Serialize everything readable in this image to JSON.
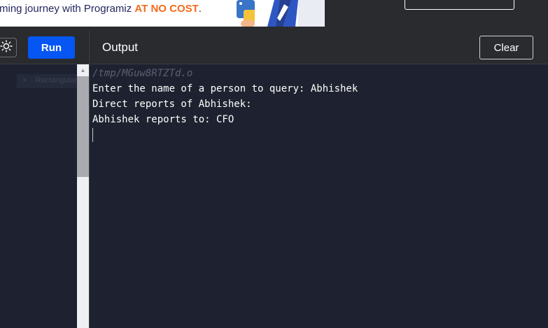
{
  "banner": {
    "text_main": "ming journey with Programiz ",
    "text_highlight": "AT NO COST",
    "text_end": "."
  },
  "toolbar": {
    "run_label": "Run",
    "output_title": "Output",
    "clear_label": "Clear"
  },
  "editor": {
    "hint": "Rectangular S"
  },
  "output": {
    "lines": [
      "/tmp/MGuw8RTZTd.o",
      "Enter the name of a person to query: Abhishek",
      "Direct reports of Abhishek:",
      "Abhishek reports to: CFO"
    ]
  },
  "colors": {
    "run_button": "#0556f3",
    "banner_highlight": "#f26b1d",
    "output_background": "#1e2230"
  }
}
